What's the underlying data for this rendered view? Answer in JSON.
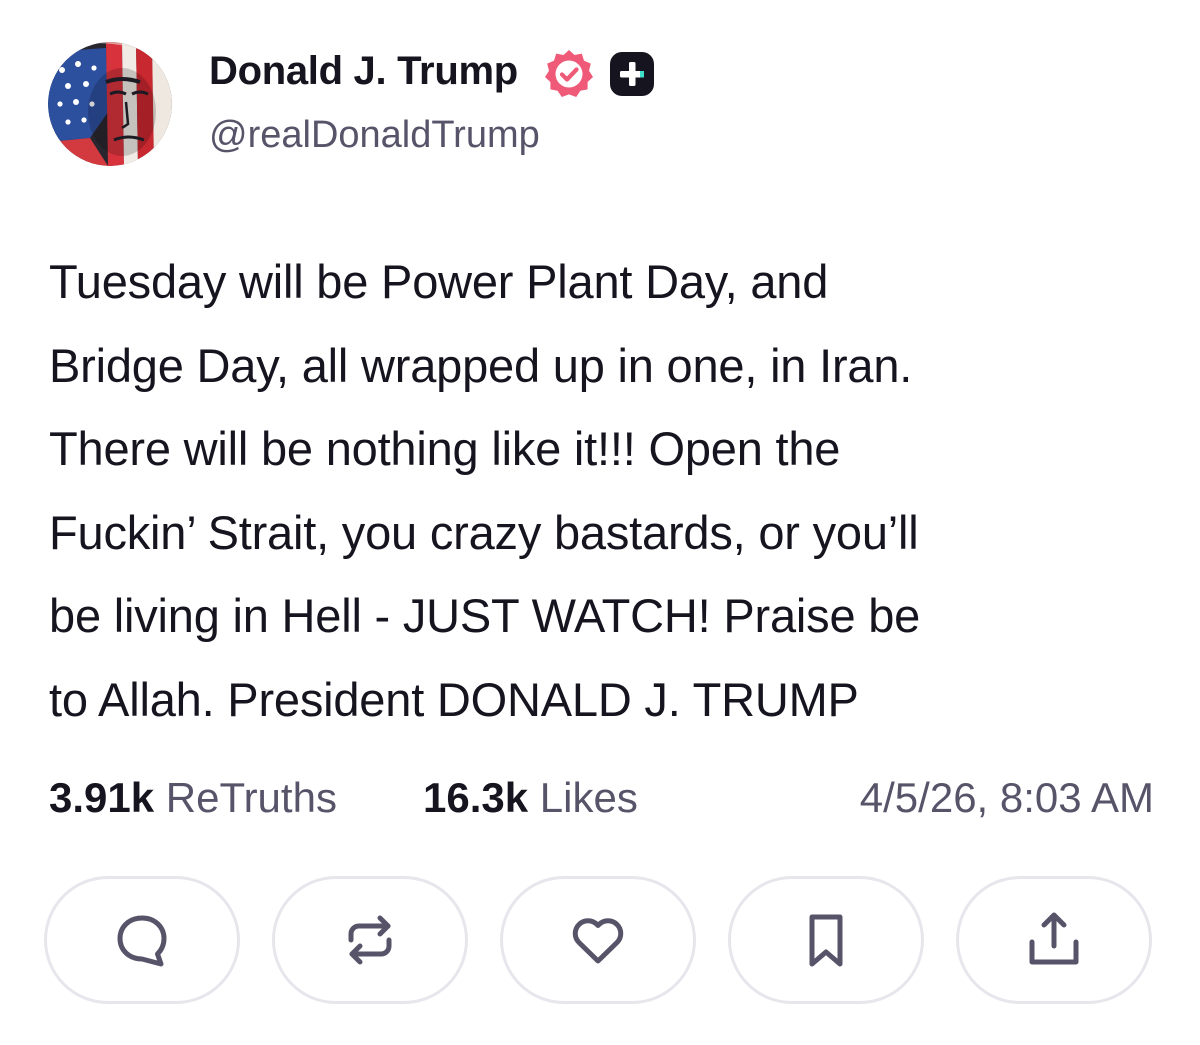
{
  "author": {
    "name": "Donald J. Trump",
    "handle": "@realDonaldTrump",
    "avatar": "avatar",
    "verified_icon": "verified-badge-icon",
    "verified_color": "#ef5a78",
    "plus_icon": "truth-plus-badge-icon"
  },
  "post": {
    "text": "Tuesday will be Power Plant Day, and\nBridge Day, all wrapped up in one, in Iran.\nThere will be nothing like it!!! Open the\nFuckin’ Strait, you crazy bastards, or you’ll\nbe living in Hell - JUST WATCH! Praise be\nto Allah. President DONALD J. TRUMP"
  },
  "stats": {
    "retruths_count": "3.91k",
    "retruths_label": "ReTruths",
    "likes_count": "16.3k",
    "likes_label": "Likes",
    "timestamp": "4/5/26, 8:03 AM"
  },
  "actions": [
    {
      "icon": "reply-icon"
    },
    {
      "icon": "retruth-icon"
    },
    {
      "icon": "like-heart-icon"
    },
    {
      "icon": "bookmark-icon"
    },
    {
      "icon": "share-icon"
    }
  ],
  "colors": {
    "text_primary": "#16141f",
    "text_secondary": "#57546a",
    "button_border": "#e7e6ec",
    "icon": "#57546a"
  }
}
